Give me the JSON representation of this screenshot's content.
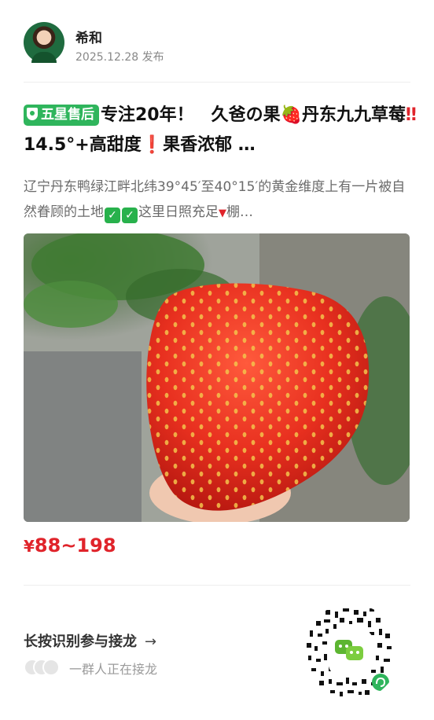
{
  "author": {
    "name": "希和",
    "date": "2025.12.28 发布"
  },
  "post": {
    "badge": "五星售后",
    "title_part1": "专注20年！　久爸の果",
    "title_berry": "🍓",
    "title_part2": "丹东九九草莓",
    "title_bang": "‼",
    "title_part3": "14.5°+高甜度",
    "title_excl": "❗",
    "title_part4": "果香浓郁 …",
    "desc_part1": "辽宁丹东鸭绿江畔北纬39°45′至40°15′的黄金维度上有一片被自然眷顾的土地",
    "check_mark": "✓",
    "desc_part2": "这里日照充足",
    "desc_tri": "▼",
    "desc_part3": "棚…"
  },
  "price": {
    "symbol": "¥",
    "range": "88~198"
  },
  "cta": {
    "label": "长按识别参与接龙",
    "arrow": "→",
    "joined_text": "一群人正在接龙"
  },
  "colors": {
    "accent_red": "#e0242b",
    "badge_green": "#2fb55c"
  },
  "icons": [
    "avatar",
    "shield-icon",
    "strawberry-emoji",
    "check-icon",
    "arrow-right-icon",
    "qr-code",
    "wechat-icon",
    "mini-program-icon"
  ]
}
